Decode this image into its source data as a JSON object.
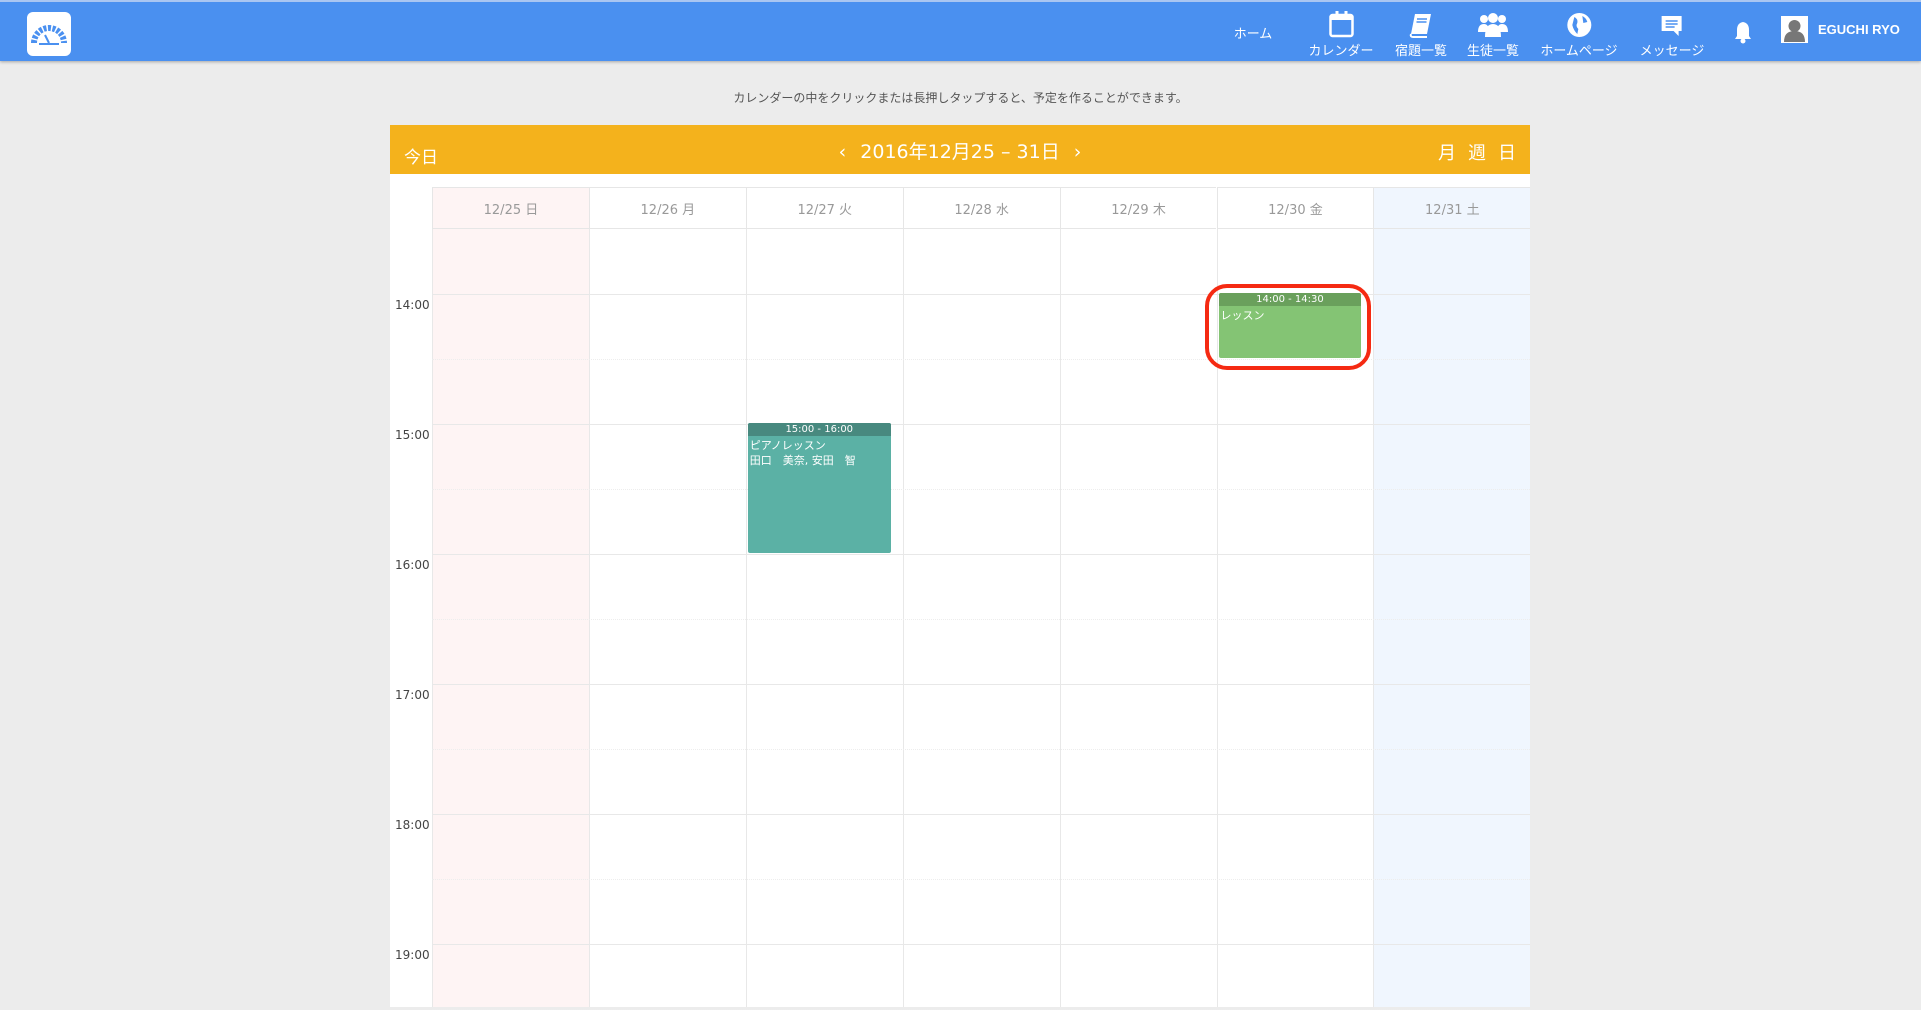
{
  "header": {
    "nav": [
      {
        "label": "ホーム",
        "icon": "none"
      },
      {
        "label": "カレンダー",
        "icon": "calendar-icon"
      },
      {
        "label": "宿題一覧",
        "icon": "book-icon"
      },
      {
        "label": "生徒一覧",
        "icon": "users-icon"
      },
      {
        "label": "ホームページ",
        "icon": "globe-icon"
      },
      {
        "label": "メッセージ",
        "icon": "message-icon"
      }
    ],
    "user": "EGUCHI RYO",
    "avatar_text": "No image"
  },
  "hint": "カレンダーの中をクリックまたは長押しタップすると、予定を作ることができます。",
  "toolbar": {
    "today": "今日",
    "prev": "‹",
    "title": "2016年12月25 – 31日",
    "next": "›",
    "views": [
      "月",
      "週",
      "日"
    ]
  },
  "days": [
    "12/25 日",
    "12/26 月",
    "12/27 火",
    "12/28 水",
    "12/29 木",
    "12/30 金",
    "12/31 土"
  ],
  "times": [
    "14:00",
    "15:00",
    "16:00",
    "17:00",
    "18:00",
    "19:00"
  ],
  "events": [
    {
      "time": "14:00 - 14:30",
      "title": "レッスン",
      "detail": "",
      "color": "#84c474",
      "head": "#6aa05c"
    },
    {
      "time": "15:00 - 16:00",
      "title": "ピアノレッスン",
      "detail": "田口　美奈, 安田　智",
      "color": "#5bb1a5",
      "head": "#48897f"
    }
  ],
  "colors": {
    "sunday": "#fef4f4",
    "saturday": "#f0f6fe",
    "header": "#4a90f0",
    "toolbar": "#f4b21c"
  }
}
